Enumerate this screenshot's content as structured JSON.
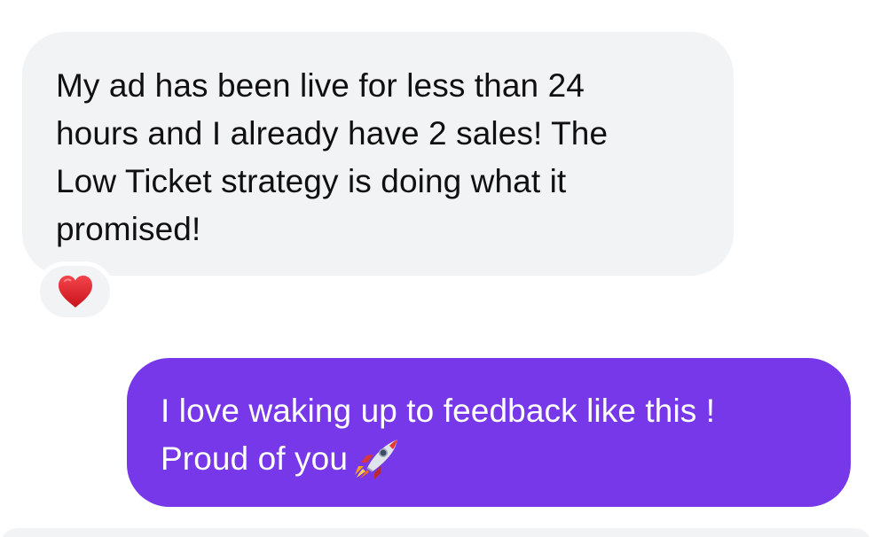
{
  "conversation": {
    "incoming": {
      "text": "My ad has been live for less than 24\nhours and I already have 2 sales! The\nLow Ticket strategy is doing what it\npromised!",
      "bubble_color": "#f2f3f5",
      "text_color": "#101010",
      "reaction": {
        "icon": "red-heart-icon",
        "color": "#e0262b"
      }
    },
    "outgoing": {
      "line1": "I love waking up to feedback like this !",
      "line2": "Proud of you",
      "trailing_icon": "rocket-icon",
      "bubble_color": "#7638e8",
      "text_color": "#ffffff"
    }
  }
}
